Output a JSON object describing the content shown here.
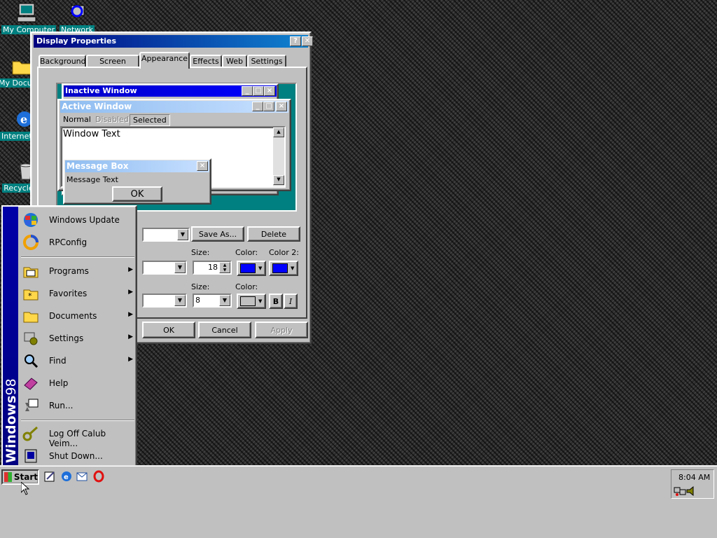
{
  "desktop": {
    "icons": [
      {
        "label": "My Computer",
        "name": "my-computer-icon"
      },
      {
        "label": "Network",
        "name": "network-icon"
      },
      {
        "label": "My Documents",
        "name": "my-documents-icon"
      },
      {
        "label": "Internet Explorer",
        "name": "internet-explorer-icon"
      },
      {
        "label": "Recycle Bin",
        "name": "recycle-bin-icon"
      }
    ]
  },
  "dialog": {
    "title": "Display Properties",
    "help_label": "?",
    "close_label": "✕",
    "tabs": [
      "Background",
      "Screen Saver",
      "Appearance",
      "Effects",
      "Web",
      "Settings"
    ],
    "active_tab": "Appearance",
    "preview": {
      "inactive_title": "Inactive Window",
      "active_title": "Active Window",
      "menu": [
        "Normal",
        "Disabled",
        "Selected"
      ],
      "window_text": "Window Text",
      "msgbox_title": "Message Box",
      "msgbox_text": "Message Text",
      "msgbox_ok": "OK"
    },
    "scheme_save_as": "Save As...",
    "scheme_delete": "Delete",
    "item_size_label": "Size:",
    "item_size_value": "18",
    "item_color_label": "Color:",
    "item_color2_label": "Color 2:",
    "font_size_label": "Size:",
    "font_size_value": "8",
    "font_color_label": "Color:",
    "bold_label": "B",
    "italic_label": "I",
    "ok_label": "OK",
    "cancel_label": "Cancel",
    "apply_label": "Apply",
    "colors": {
      "item_color": "#0000ff",
      "item_color2": "#0000ff",
      "font_color": "#c0c0c0"
    }
  },
  "start_menu": {
    "band_text_bold": "Windows",
    "band_text_light": "98",
    "items": [
      {
        "label": "Windows Update",
        "icon": "windows-update-icon",
        "submenu": false
      },
      {
        "label": "RPConfig",
        "icon": "rpconfig-icon",
        "submenu": false
      },
      {
        "label": "Programs",
        "icon": "programs-icon",
        "submenu": true
      },
      {
        "label": "Favorites",
        "icon": "favorites-icon",
        "submenu": true
      },
      {
        "label": "Documents",
        "icon": "documents-icon",
        "submenu": true
      },
      {
        "label": "Settings",
        "icon": "settings-icon",
        "submenu": true
      },
      {
        "label": "Find",
        "icon": "find-icon",
        "submenu": true
      },
      {
        "label": "Help",
        "icon": "help-icon",
        "submenu": false
      },
      {
        "label": "Run...",
        "icon": "run-icon",
        "submenu": false
      },
      {
        "label": "Log Off Calub Veim...",
        "icon": "log-off-icon",
        "submenu": false
      },
      {
        "label": "Shut Down...",
        "icon": "shut-down-icon",
        "submenu": false
      }
    ]
  },
  "taskbar": {
    "start_label": "Start",
    "quick_launch": [
      "edit-icon",
      "internet-explorer-icon",
      "outlook-express-icon",
      "opera-icon"
    ],
    "clock": "8:04 AM"
  }
}
